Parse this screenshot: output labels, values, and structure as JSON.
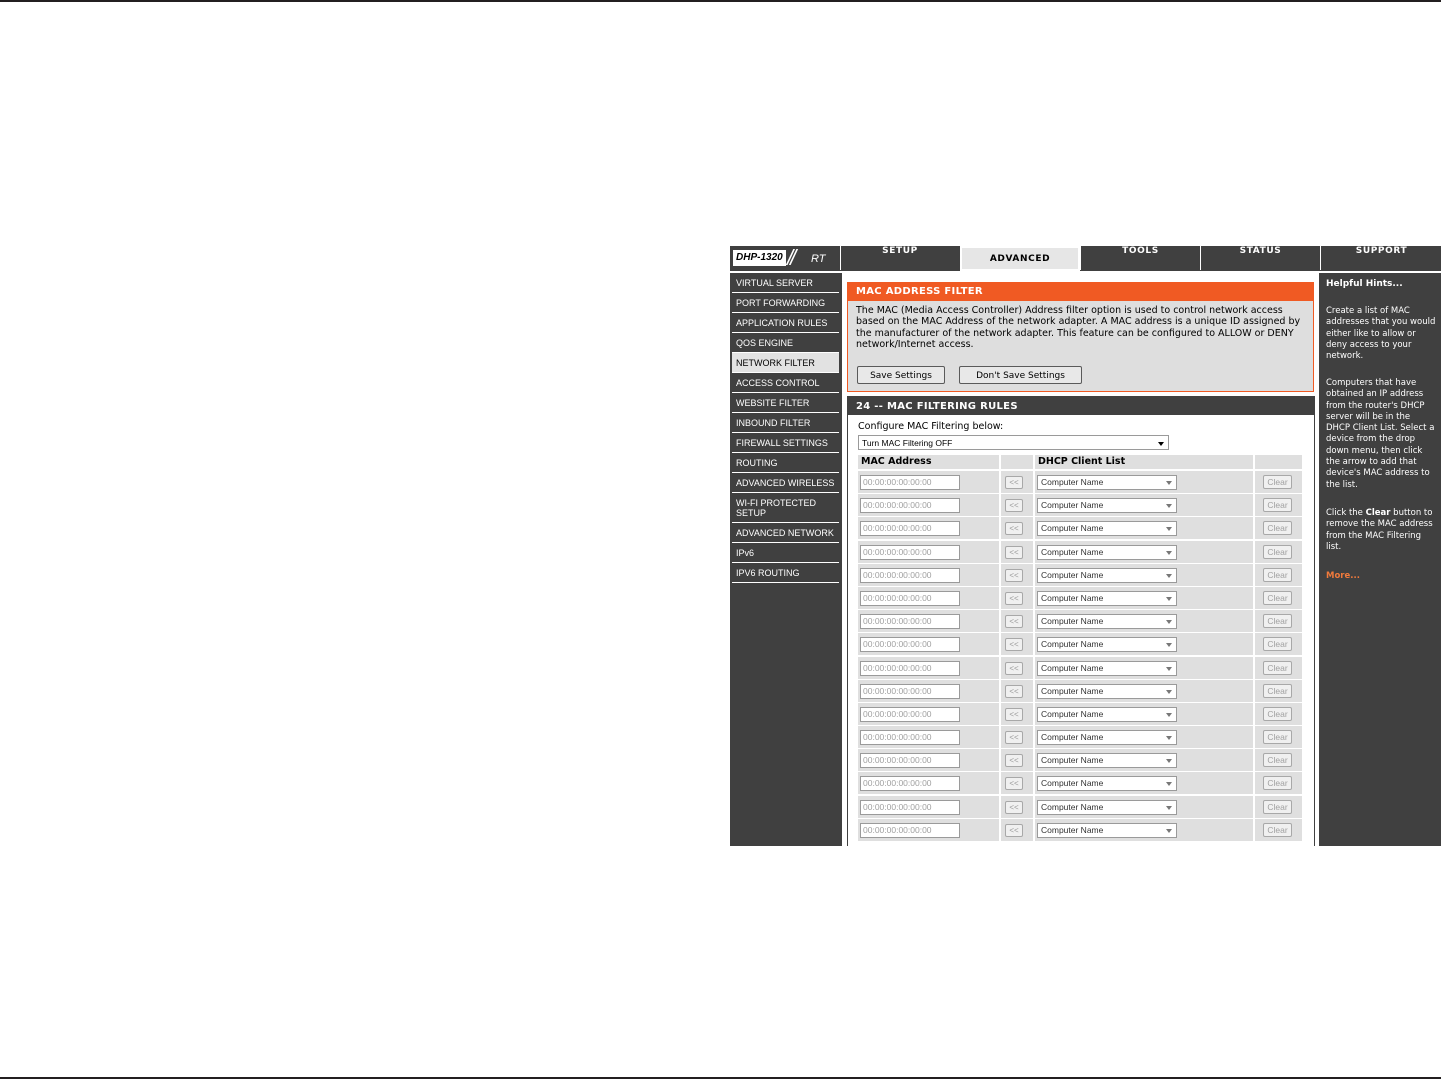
{
  "brand": {
    "model": "DHP-1320",
    "separator": "//",
    "suffix": "RT"
  },
  "tabs": [
    {
      "label": "SETUP",
      "active": false
    },
    {
      "label": "ADVANCED",
      "active": true
    },
    {
      "label": "TOOLS",
      "active": false
    },
    {
      "label": "STATUS",
      "active": false
    },
    {
      "label": "SUPPORT",
      "active": false
    }
  ],
  "sidebar": {
    "items": [
      {
        "label": "VIRTUAL SERVER",
        "selected": false
      },
      {
        "label": "PORT FORWARDING",
        "selected": false
      },
      {
        "label": "APPLICATION RULES",
        "selected": false
      },
      {
        "label": "QOS ENGINE",
        "selected": false
      },
      {
        "label": "NETWORK FILTER",
        "selected": true
      },
      {
        "label": "ACCESS CONTROL",
        "selected": false
      },
      {
        "label": "WEBSITE FILTER",
        "selected": false
      },
      {
        "label": "INBOUND FILTER",
        "selected": false
      },
      {
        "label": "FIREWALL SETTINGS",
        "selected": false
      },
      {
        "label": "ROUTING",
        "selected": false
      },
      {
        "label": "ADVANCED WIRELESS",
        "selected": false
      },
      {
        "label": "WI-FI PROTECTED SETUP",
        "selected": false
      },
      {
        "label": "ADVANCED NETWORK",
        "selected": false
      },
      {
        "label": "IPv6",
        "selected": false
      },
      {
        "label": "IPV6 ROUTING",
        "selected": false
      }
    ]
  },
  "filter": {
    "title": "MAC ADDRESS FILTER",
    "description": "The MAC (Media Access Controller) Address filter option is used to control network access based on the MAC Address of the network adapter. A MAC address is a unique ID assigned by the manufacturer of the network adapter. This feature can be configured to ALLOW or DENY network/Internet access.",
    "save_label": "Save Settings",
    "dont_save_label": "Don't Save Settings"
  },
  "rules": {
    "title": "24 -- MAC FILTERING RULES",
    "configure_label": "Configure MAC Filtering below:",
    "mode_selected": "Turn MAC Filtering OFF",
    "headers": {
      "mac": "MAC Address",
      "dhcp": "DHCP Client List"
    },
    "row_count": 16,
    "mac_placeholder": "00:00:00:00:00:00",
    "copy_label": "<<",
    "client_default": "Computer Name",
    "clear_label": "Clear"
  },
  "hints": {
    "title": "Helpful Hints...",
    "p1": "Create a list of MAC addresses that you would either like to allow or deny access to your network.",
    "p2": "Computers that have obtained an IP address from the router's DHCP server will be in the DHCP Client List. Select a device from the drop down menu, then click the arrow to add that device's MAC address to the list.",
    "p3_pre": "Click the ",
    "p3_bold": "Clear",
    "p3_post": " button to remove the MAC address from the MAC Filtering list.",
    "more": "More..."
  },
  "colors": {
    "accent": "#f05a23",
    "nav_bg": "#404040",
    "panel_gray": "#dedede",
    "link": "#f07a3c"
  }
}
